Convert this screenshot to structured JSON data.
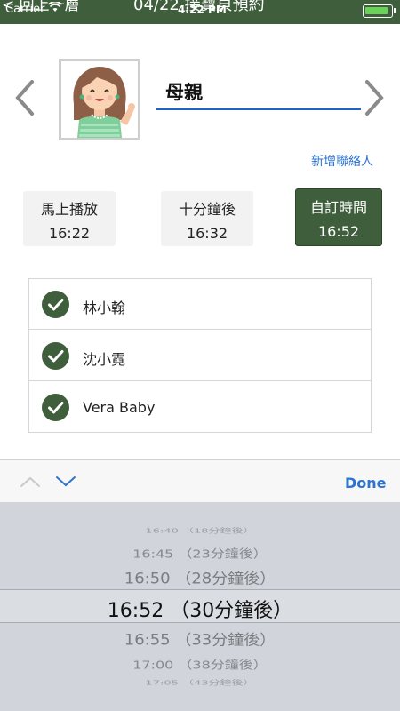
{
  "status_bar": {
    "carrier": "Carrier",
    "time": "4:22 PM",
    "battery_color": "#6cd15a"
  },
  "nav": {
    "back_label": "< 回上一層",
    "title": "04/22 接寶貝預約",
    "bar_color": "#3f5e3c"
  },
  "contact": {
    "name": "母親",
    "add_contact_label": "新增聯絡人",
    "prev_icon": "chevron-left-icon",
    "next_icon": "chevron-right-icon"
  },
  "time_options": [
    {
      "label": "馬上播放",
      "time": "16:22",
      "selected": false
    },
    {
      "label": "十分鐘後",
      "time": "16:32",
      "selected": false
    },
    {
      "label": "自訂時間",
      "time": "16:52",
      "selected": true
    }
  ],
  "recipients": [
    {
      "name": "林小翰",
      "checked": true
    },
    {
      "name": "沈小霓",
      "checked": true
    },
    {
      "name": "Vera Baby",
      "checked": true
    }
  ],
  "keyboard_toolbar": {
    "done_label": "Done",
    "up_icon": "chevron-up-icon",
    "down_icon": "chevron-down-icon"
  },
  "picker": {
    "items": [
      "16:40 （18分鐘後）",
      "16:45 （23分鐘後）",
      "16:50 （28分鐘後）",
      "16:52 （30分鐘後）",
      "16:55 （33分鐘後）",
      "17:00 （38分鐘後）",
      "17:05 （43分鐘後）"
    ],
    "selected_index": 3
  },
  "colors": {
    "accent": "#3f5e3c",
    "link": "#2d74d0",
    "underline": "#1f64c4"
  }
}
